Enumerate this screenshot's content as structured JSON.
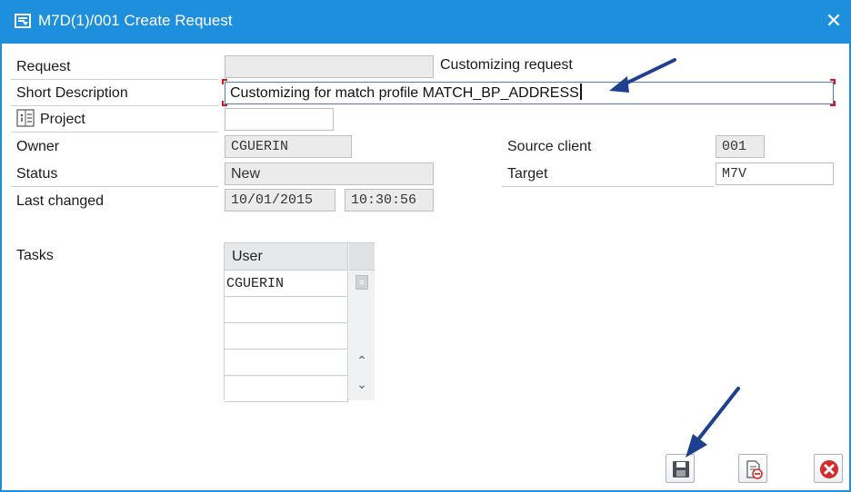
{
  "window": {
    "title": "M7D(1)/001 Create Request",
    "close_glyph": "✕"
  },
  "form": {
    "request_label": "Request",
    "request_value": "",
    "request_type": "Customizing request",
    "short_desc_label": "Short Description",
    "short_desc_value": "Customizing for match profile MATCH_BP_ADDRESS",
    "project_label": "Project",
    "project_value": "",
    "owner_label": "Owner",
    "owner_value": "CGUERIN",
    "status_label": "Status",
    "status_value": "New",
    "last_changed_label": "Last changed",
    "last_changed_date": "10/01/2015",
    "last_changed_time": "10:30:56",
    "source_client_label": "Source client",
    "source_client_value": "001",
    "target_label": "Target",
    "target_value": "M7V"
  },
  "tasks": {
    "label": "Tasks",
    "column_header": "User",
    "rows": [
      "CGUERIN",
      "",
      "",
      "",
      ""
    ]
  },
  "toolbar": {
    "buttons": [
      {
        "name": "save",
        "icon": "save-icon"
      },
      {
        "name": "cancel",
        "icon": "document-remove-icon"
      },
      {
        "name": "close",
        "icon": "cancel-icon"
      }
    ]
  },
  "colors": {
    "title_bar": "#1d8fdc",
    "annotation_arrow": "#1f3f8f",
    "cancel_red": "#d42b2b",
    "required_marker": "#dd1111"
  }
}
